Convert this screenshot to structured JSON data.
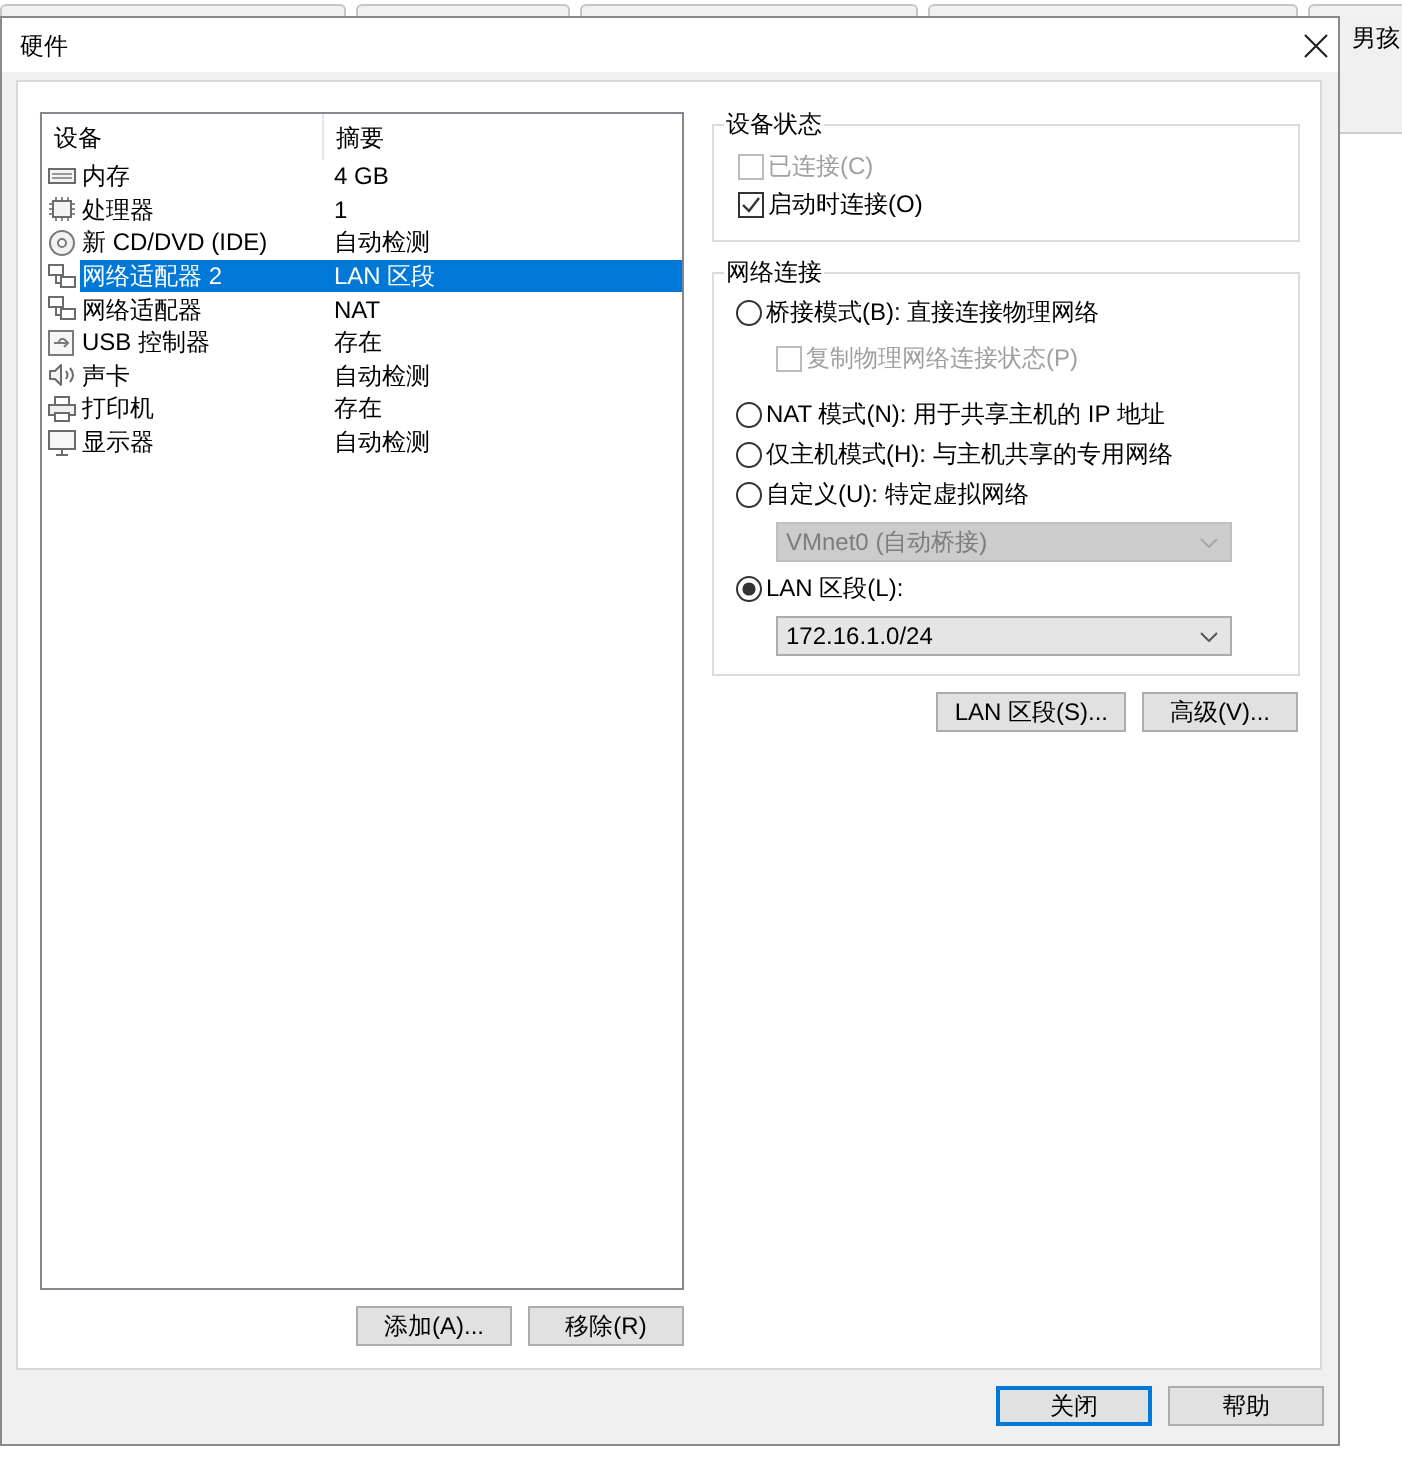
{
  "background": {
    "text": "男孩"
  },
  "window": {
    "title": "硬件"
  },
  "device_list": {
    "columns": [
      "设备",
      "摘要"
    ],
    "rows": [
      {
        "kind": "memory",
        "device": "内存",
        "summary": "4 GB",
        "selected": false
      },
      {
        "kind": "processor",
        "device": "处理器",
        "summary": "1",
        "selected": false
      },
      {
        "kind": "disc",
        "device": "新 CD/DVD (IDE)",
        "summary": "自动检测",
        "selected": false
      },
      {
        "kind": "network",
        "device": "网络适配器 2",
        "summary": "LAN 区段",
        "selected": true
      },
      {
        "kind": "network",
        "device": "网络适配器",
        "summary": "NAT",
        "selected": false
      },
      {
        "kind": "usb",
        "device": "USB 控制器",
        "summary": "存在",
        "selected": false
      },
      {
        "kind": "sound",
        "device": "声卡",
        "summary": "自动检测",
        "selected": false
      },
      {
        "kind": "printer",
        "device": "打印机",
        "summary": "存在",
        "selected": false
      },
      {
        "kind": "display",
        "device": "显示器",
        "summary": "自动检测",
        "selected": false
      }
    ]
  },
  "list_buttons": [
    "添加(A)...",
    "移除(R)"
  ],
  "device_status": {
    "title": "设备状态",
    "options": [
      {
        "label": "已连接(C)",
        "checked": false,
        "disabled": true
      },
      {
        "label": "启动时连接(O)",
        "checked": true,
        "disabled": false
      }
    ]
  },
  "network_connection": {
    "title": "网络连接",
    "options": [
      {
        "kind": "radio",
        "label": "桥接模式(B): 直接连接物理网络",
        "selected": false
      },
      {
        "kind": "checkbox",
        "label": "复制物理网络连接状态(P)",
        "checked": false,
        "disabled": true
      },
      {
        "kind": "radio",
        "label": "NAT 模式(N): 用于共享主机的 IP 地址",
        "selected": false
      },
      {
        "kind": "radio",
        "label": "仅主机模式(H): 与主机共享的专用网络",
        "selected": false
      },
      {
        "kind": "radio",
        "label": "自定义(U): 特定虚拟网络",
        "selected": false
      },
      {
        "kind": "dropdown",
        "value": "VMnet0 (自动桥接)",
        "disabled": true
      },
      {
        "kind": "radio",
        "label": "LAN 区段(L):",
        "selected": true
      },
      {
        "kind": "dropdown",
        "value": "172.16.1.0/24",
        "disabled": false
      }
    ]
  },
  "network_buttons": [
    "LAN 区段(S)...",
    "高级(V)..."
  ],
  "dialog_buttons": [
    {
      "label": "关闭",
      "default": true
    },
    {
      "label": "帮助",
      "default": false
    }
  ]
}
